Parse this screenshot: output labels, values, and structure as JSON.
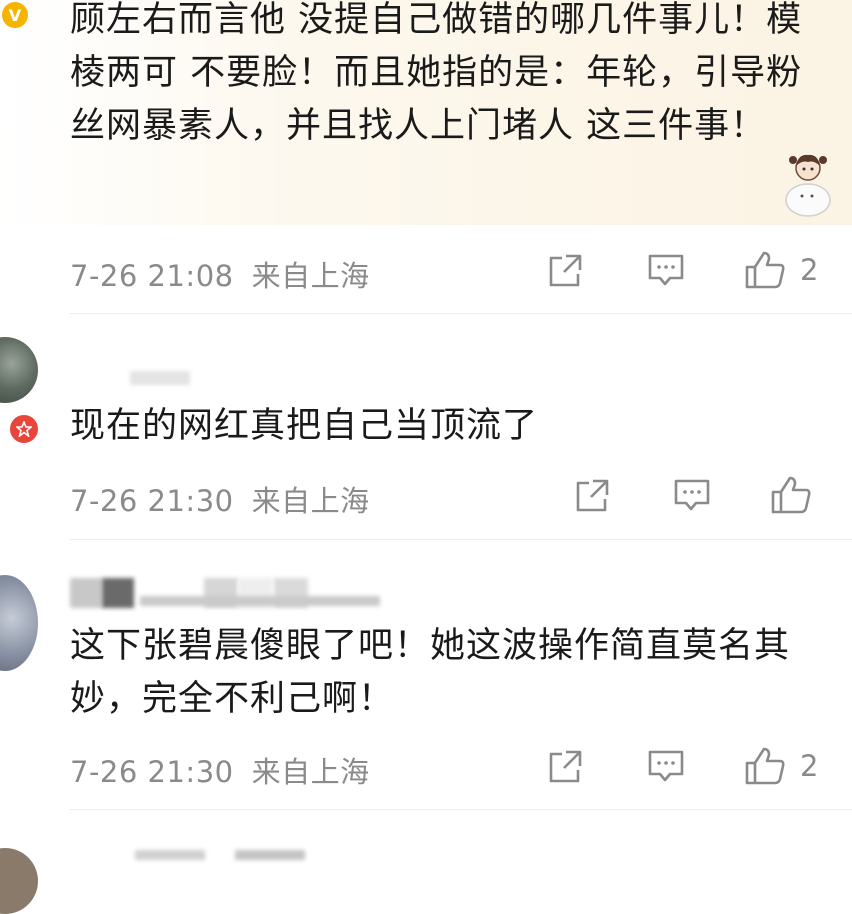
{
  "comments": [
    {
      "text": "顾左右而言他 没提自己做错的哪几件事儿！模棱两可 不要脸！而且她指的是：年轮，引导粉丝网暴素人，并且找人上门堵人 这三件事！",
      "date": "7-26 21:08",
      "location": "来自上海",
      "likes": "2",
      "badge": "V",
      "badge_color": "#f5b400"
    },
    {
      "text": "现在的网红真把自己当顶流了",
      "date": "7-26 21:30",
      "location": "来自上海",
      "likes": "",
      "badge_color": "#e8463a"
    },
    {
      "text": "这下张碧晨傻眼了吧！她这波操作简直莫名其妙，完全不利己啊！",
      "date": "7-26 21:30",
      "location": "来自上海",
      "likes": "2"
    }
  ],
  "icons": {
    "share": "share-icon",
    "comment": "comment-icon",
    "like": "like-icon"
  },
  "colors": {
    "meta_text": "#8a8a8a",
    "divider": "#ececec",
    "highlight_bg": "#fdf8ee"
  }
}
